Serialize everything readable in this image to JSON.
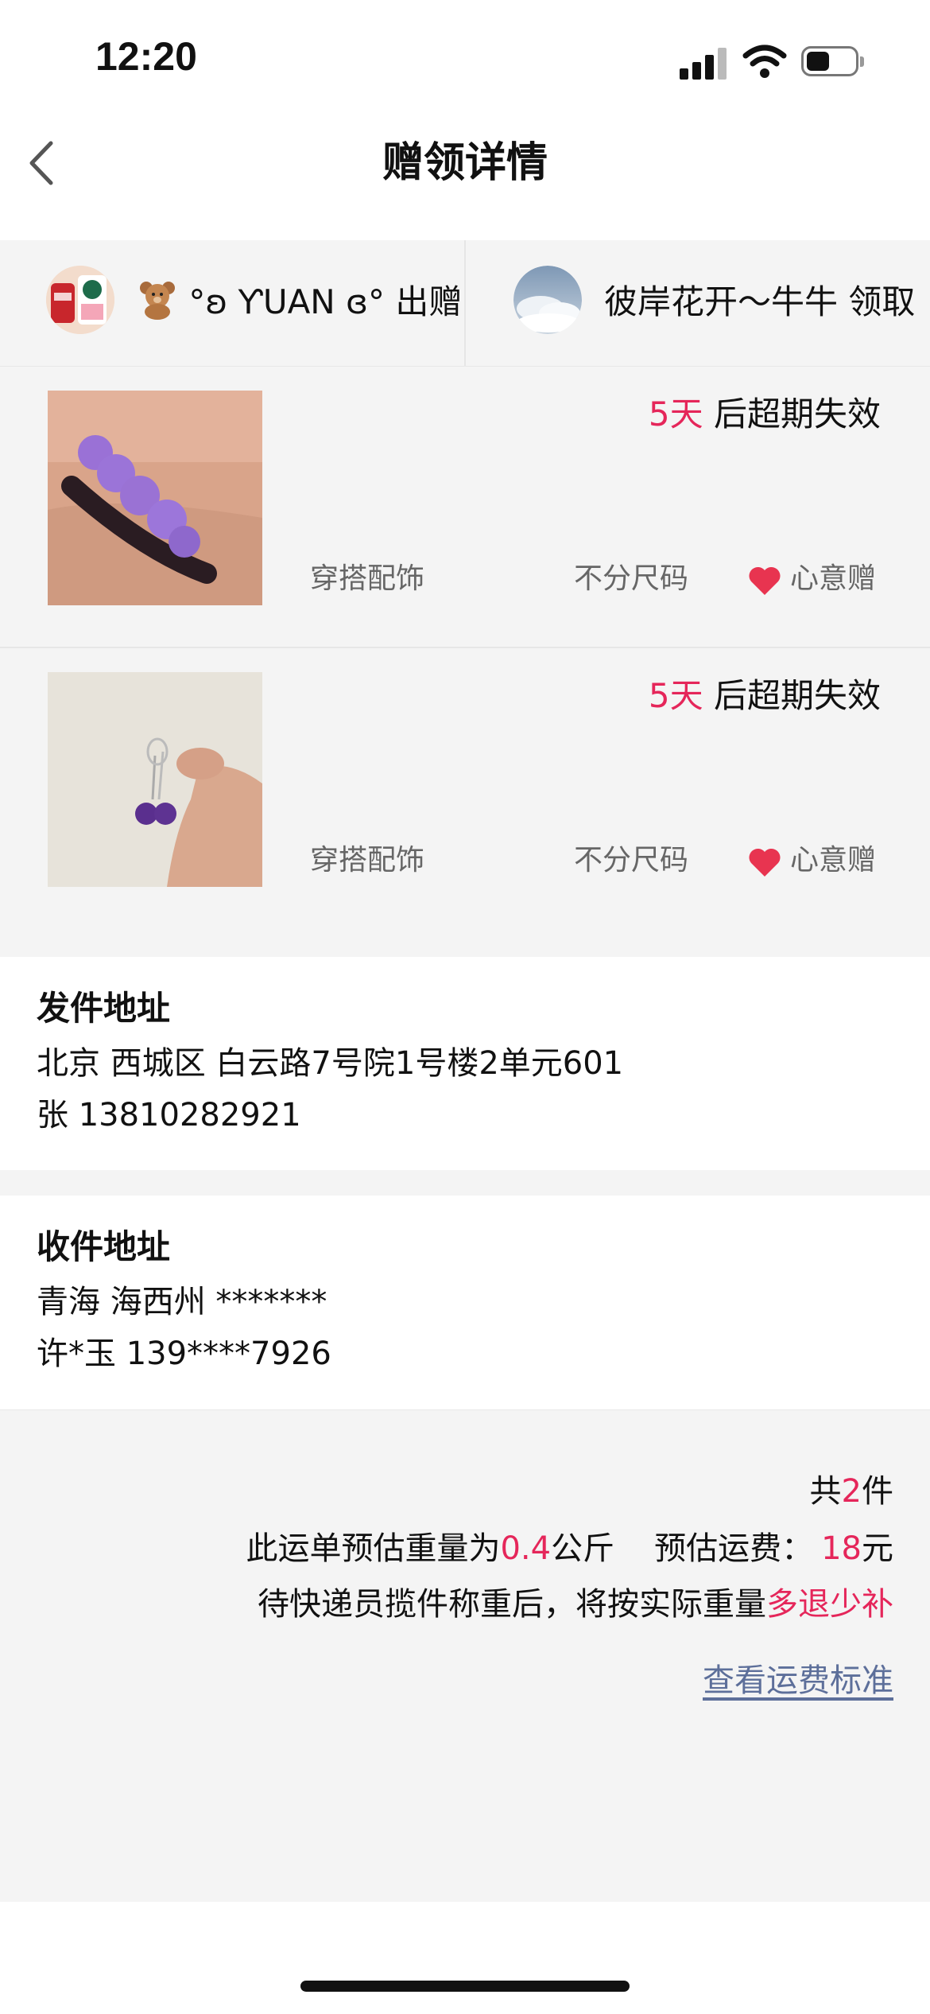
{
  "status_bar": {
    "time": "12:20"
  },
  "nav": {
    "title": "赠领详情"
  },
  "giver": {
    "name": "°ʚ ƳUAN ɞ°",
    "action": "出赠"
  },
  "receiver": {
    "name": "彼岸花开～牛牛",
    "action": "领取"
  },
  "items": [
    {
      "expire_num": "5天",
      "expire_text": " 后超期失效",
      "category": "穿搭配饰",
      "size": "不分尺码",
      "gift_type": "心意赠"
    },
    {
      "expire_num": "5天",
      "expire_text": " 后超期失效",
      "category": "穿搭配饰",
      "size": "不分尺码",
      "gift_type": "心意赠"
    }
  ],
  "sender_address": {
    "title": "发件地址",
    "line1": "北京 西城区 白云路7号院1号楼2单元601",
    "line2": "张 13810282921"
  },
  "receiver_address": {
    "title": "收件地址",
    "line1": "青海 海西州 *******",
    "line2": "许*玉 139****7926"
  },
  "summary": {
    "count_prefix": "共",
    "count": "2",
    "count_suffix": "件",
    "weight_prefix": "此运单预估重量为",
    "weight": "0.4",
    "weight_suffix": "公斤",
    "fee_label": "预估运费：",
    "fee": "18",
    "fee_suffix": "元",
    "note_prefix": "待快递员揽件称重后，将按实际重量",
    "note_highlight": "多退少补",
    "link": "查看运费标准"
  },
  "colors": {
    "accent": "#e5265a",
    "link": "#5d6f9a",
    "background": "#f4f4f4"
  }
}
